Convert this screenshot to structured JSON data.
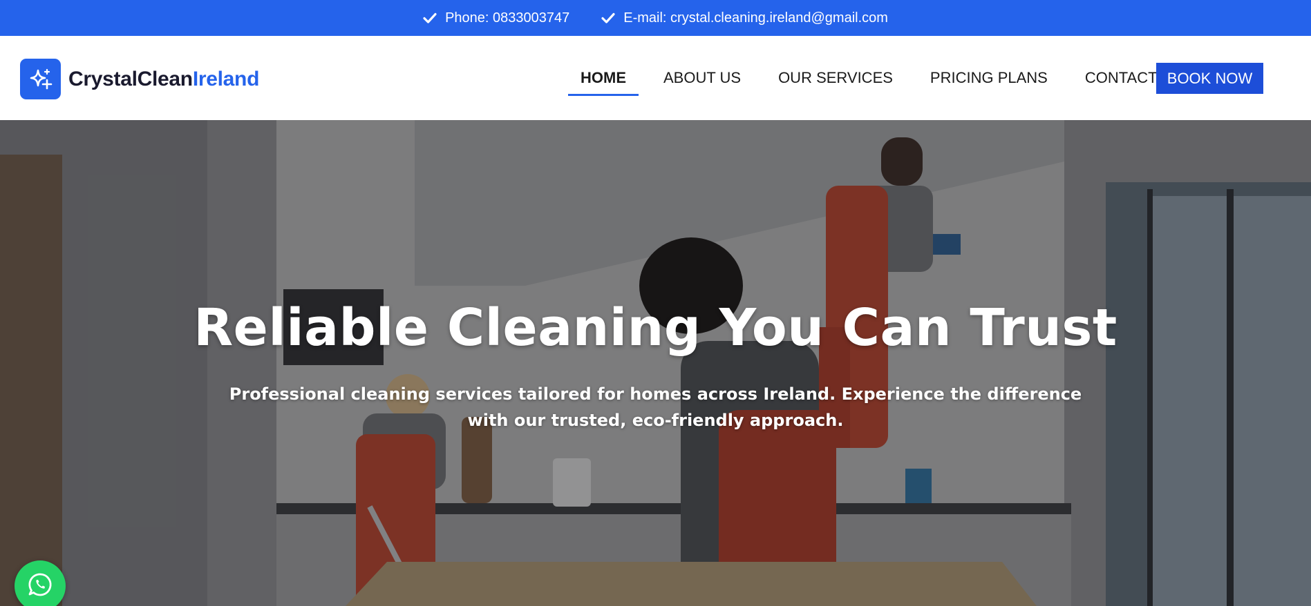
{
  "topbar": {
    "phone": "Phone: 0833003747",
    "email": "E-mail: crystal.cleaning.ireland@gmail.com",
    "icon": "check-icon",
    "background": "#2563eb"
  },
  "logo": {
    "name_part1": "CrystalClean",
    "name_part2": "Ireland",
    "icon": "sparkle-icon",
    "accent": "#2563eb"
  },
  "nav": {
    "items": [
      {
        "label": "HOME",
        "active": true
      },
      {
        "label": "ABOUT US",
        "active": false
      },
      {
        "label": "OUR SERVICES",
        "active": false
      },
      {
        "label": "PRICING PLANS",
        "active": false
      },
      {
        "label": "CONTACT",
        "active": false
      }
    ],
    "cta_label": "BOOK NOW"
  },
  "hero": {
    "title": "Reliable Cleaning You Can Trust",
    "subtitle": "Professional cleaning services tailored for homes across Ireland. Experience the difference with our trusted, eco-friendly approach."
  },
  "floating": {
    "whatsapp_icon": "whatsapp-icon",
    "whatsapp_color": "#25d366"
  }
}
